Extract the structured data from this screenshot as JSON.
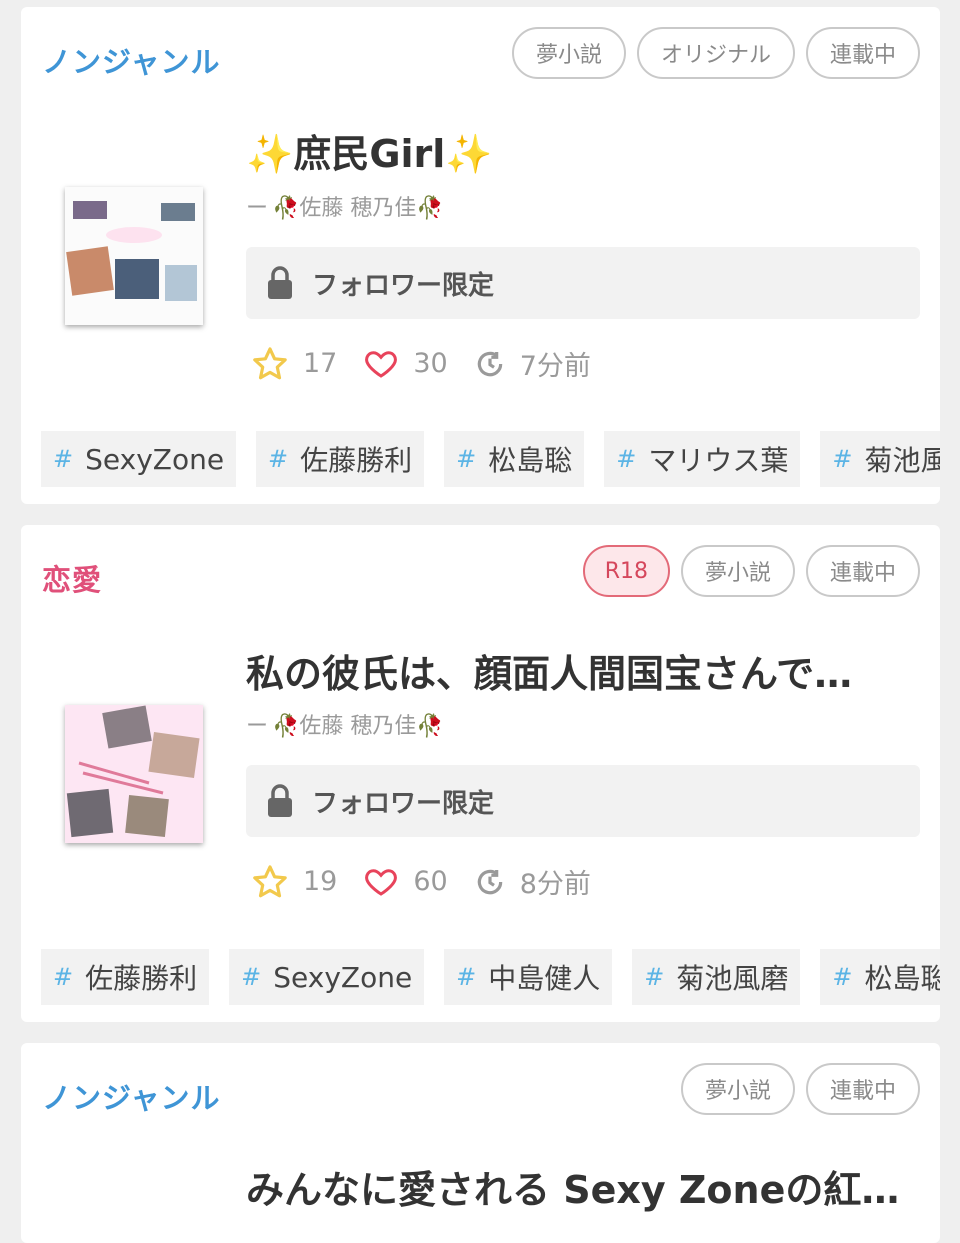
{
  "colors": {
    "genre_nongenre": "#3f95d6",
    "genre_romance": "#e0507a",
    "tag_hash": "#5bb4e5",
    "star": "#f2c94c",
    "heart": "#e8435b"
  },
  "cards": [
    {
      "genre": "ノンジャンル",
      "badges": [
        "夢小説",
        "オリジナル",
        "連載中"
      ],
      "title_sparkle_left": "✨",
      "title": "庶民Girl",
      "title_sparkle_right": "✨",
      "author_prefix": "ー",
      "author": "🥀佐藤 穂乃佳🥀",
      "lock_label": "フォロワー限定",
      "stars": "17",
      "likes": "30",
      "updated": "7分前",
      "tags": [
        "SexyZone",
        "佐藤勝利",
        "松島聡",
        "マリウス葉",
        "菊池風"
      ]
    },
    {
      "genre": "恋愛",
      "badges": [
        "R18",
        "夢小説",
        "連載中"
      ],
      "title": "私の彼氏は、顔面人間国宝さんで…",
      "author_prefix": "ー",
      "author": "🥀佐藤 穂乃佳🥀",
      "lock_label": "フォロワー限定",
      "stars": "19",
      "likes": "60",
      "updated": "8分前",
      "tags": [
        "佐藤勝利",
        "SexyZone",
        "中島健人",
        "菊池風磨",
        "松島聡"
      ]
    },
    {
      "genre": "ノンジャンル",
      "badges": [
        "夢小説",
        "連載中"
      ],
      "title": "みんなに愛される Sexy Zoneの紅…"
    }
  ],
  "icons": {
    "star": "star-icon",
    "heart": "heart-icon",
    "clock": "clock-icon",
    "lock": "lock-icon",
    "rose": "rose-emoji"
  }
}
